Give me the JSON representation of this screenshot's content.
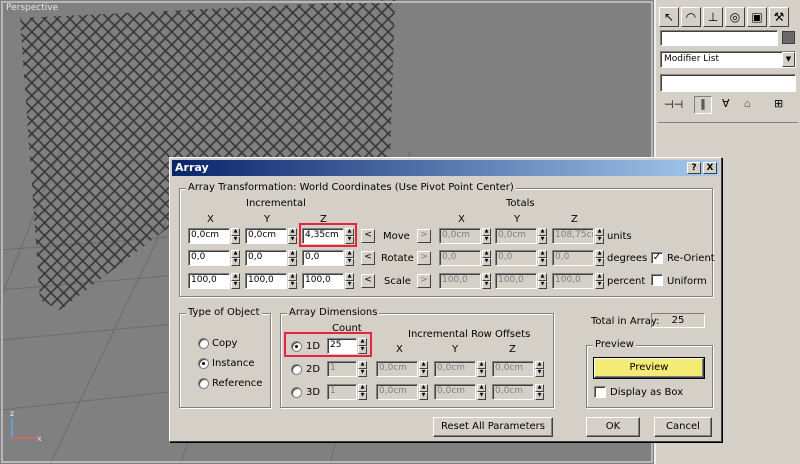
{
  "viewport": {
    "label": "Perspective",
    "axis_x": "x",
    "axis_z": "z"
  },
  "command_panel": {
    "tabs": [
      "pointer-icon",
      "modify-icon",
      "hierarchy-icon",
      "motion-icon",
      "display-icon"
    ],
    "modifier_list": "Modifier List"
  },
  "dialog": {
    "title": "Array",
    "help_btn": "?",
    "close_btn": "X",
    "transformation": {
      "group_label": "Array Transformation: World Coordinates (Use Pivot Point Center)",
      "incremental_label": "Incremental",
      "totals_label": "Totals",
      "axis_x": "X",
      "axis_y": "Y",
      "axis_z": "Z",
      "move_label": "Move",
      "rotate_label": "Rotate",
      "scale_label": "Scale",
      "units_label": "units",
      "degrees_label": "degrees",
      "percent_label": "percent",
      "move_inc": [
        "0,0cm",
        "0,0cm",
        "4,35cm"
      ],
      "rotate_inc": [
        "0,0",
        "0,0",
        "0,0"
      ],
      "scale_inc": [
        "100,0",
        "100,0",
        "100,0"
      ],
      "move_tot": [
        "0,0cm",
        "0,0cm",
        "108,75cm"
      ],
      "rotate_tot": [
        "0,0",
        "0,0",
        "0,0"
      ],
      "scale_tot": [
        "100,0",
        "100,0",
        "100,0"
      ],
      "reorient_label": "Re-Orient",
      "uniform_label": "Uniform",
      "arrow_left": "<",
      "arrow_right": ">"
    },
    "type_of_object": {
      "label": "Type of Object",
      "copy": "Copy",
      "instance": "Instance",
      "reference": "Reference"
    },
    "array_dimensions": {
      "label": "Array Dimensions",
      "count_label": "Count",
      "offsets_label": "Incremental Row Offsets",
      "x": "X",
      "y": "Y",
      "z": "Z",
      "d1": "1D",
      "d2": "2D",
      "d3": "3D",
      "count_1d": "25",
      "count_2d": "1",
      "count_3d": "1",
      "off_2d": [
        "0,0cm",
        "0,0cm",
        "0,0cm"
      ],
      "off_3d": [
        "0,0cm",
        "0,0cm",
        "0,0cm"
      ]
    },
    "total_in_array_label": "Total in Array:",
    "total_in_array_value": "25",
    "preview": {
      "label": "Preview",
      "button": "Preview",
      "display_as_box": "Display as Box"
    },
    "reset_button": "Reset All Parameters",
    "ok_button": "OK",
    "cancel_button": "Cancel"
  }
}
